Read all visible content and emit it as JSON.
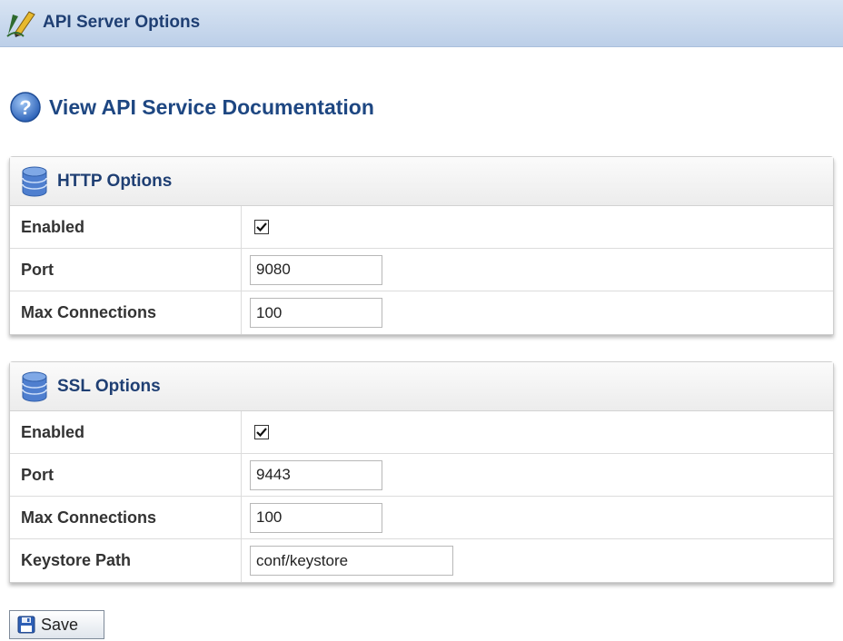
{
  "header": {
    "title": "API Server Options",
    "icon": "pencil-logo-icon"
  },
  "doc_link": {
    "label": "View API Service Documentation",
    "icon": "help-icon"
  },
  "http": {
    "title": "HTTP Options",
    "icon": "database-icon",
    "enabled_label": "Enabled",
    "enabled": true,
    "port_label": "Port",
    "port": "9080",
    "maxconn_label": "Max Connections",
    "maxconn": "100"
  },
  "ssl": {
    "title": "SSL Options",
    "icon": "database-icon",
    "enabled_label": "Enabled",
    "enabled": true,
    "port_label": "Port",
    "port": "9443",
    "maxconn_label": "Max Connections",
    "maxconn": "100",
    "keystore_label": "Keystore Path",
    "keystore": "conf/keystore"
  },
  "actions": {
    "save_label": "Save",
    "save_icon": "floppy-disk-icon"
  },
  "colors": {
    "title_blue": "#1f3f73",
    "link_blue": "#1e4782",
    "header_bar": "#bccfe8"
  }
}
